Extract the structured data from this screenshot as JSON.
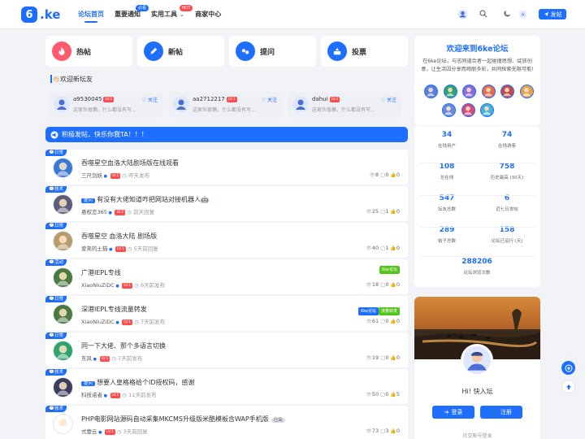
{
  "header": {
    "logo_letter": "6",
    "logo_text": ".ke",
    "nav": [
      {
        "label": "论坛首页",
        "active": true
      },
      {
        "label": "重要通知",
        "badge": "必看",
        "badge_color": "#1e6fff"
      },
      {
        "label": "实用工具",
        "badge": "HOT",
        "badge_color": "#ff4d4f"
      },
      {
        "label": "商家中心"
      }
    ],
    "post_button": "发帖"
  },
  "quick_actions": [
    {
      "label": "热帖",
      "icon": "fire-icon",
      "color": "#ff5a6e"
    },
    {
      "label": "新帖",
      "icon": "pencil-icon",
      "color": "#1e6fff"
    },
    {
      "label": "提问",
      "icon": "question-icon",
      "color": "#1e6fff"
    },
    {
      "label": "投票",
      "icon": "vote-icon",
      "color": "#1e6fff"
    }
  ],
  "newbie_title": "👏🏻欢迎新坛友",
  "new_users": [
    {
      "name": "a9530045",
      "level": "LV.1",
      "desc": "这家伙很懒，什么都没有写...",
      "follow": "♡ 关注"
    },
    {
      "name": "aa2712217",
      "level": "LV.1",
      "desc": "这家伙很懒，什么都没有写...",
      "follow": "♡ 关注"
    },
    {
      "name": "dahui",
      "level": "LV.1",
      "desc": "这家伙很懒，什么都没有写...",
      "follow": "♡ 关注"
    }
  ],
  "notice": "积极发帖，快乐你我TA！！！",
  "posts": [
    {
      "tag": "日常",
      "title": "吞噬星空血洛大陆剧场版在线观看",
      "author": "三尺剑妖",
      "level": "LV.1",
      "time": "昨天发布",
      "views": "8",
      "comments": "0",
      "likes": "0",
      "avatar_color": "#3a78d6"
    },
    {
      "tag": "技术",
      "prefix": "提问",
      "title": "有没有大佬知道咋把网站对接机器人🤖",
      "author": "悬权恋365",
      "level": "LV.2",
      "time": "前天回复",
      "views": "25",
      "comments": "1",
      "likes": "0",
      "avatar_color": "#5b5f7a"
    },
    {
      "tag": "日常",
      "title": "吞噬星空 血洛大陆 剧场版",
      "author": "爱笑的土猫",
      "level": "LV.1",
      "time": "5天前回复",
      "views": "40",
      "comments": "1",
      "likes": "0",
      "avatar_color": "#b89b6b"
    },
    {
      "tag": "活动",
      "title": "广港IEPL专线",
      "author": "XiaoNiuZiDC",
      "level": "LV.1",
      "time": "6天前发布",
      "views": "18",
      "comments": "0",
      "likes": "0",
      "avatar_color": "#4a7a3e",
      "tags": [
        {
          "label": "6ke论坛",
          "color": "#52c41a"
        }
      ]
    },
    {
      "tag": "日常",
      "title": "深港IEPL专线流量转发",
      "author": "XiaoNiuZiDC",
      "level": "LV.1",
      "time": "7天前发布",
      "views": "61",
      "comments": "0",
      "likes": "0",
      "avatar_color": "#4a7a3e",
      "tags": [
        {
          "label": "6ke论坛",
          "color": "#1e6fff"
        },
        {
          "label": "流量转发",
          "color": "#52c41a"
        }
      ]
    },
    {
      "tag": "日常",
      "title": "同一下大佬、那个多语言切换",
      "author": "东风",
      "level": "LV.1",
      "time": "7天前发布",
      "views": "19",
      "comments": "0",
      "likes": "0",
      "avatar_color": "#2fa36b"
    },
    {
      "tag": "技术",
      "prefix": "提问",
      "title": "想要人皇格格给个ID授权码，感谢",
      "author": "科技诺者",
      "level": "LV.1",
      "time": "11天前发布",
      "views": "50",
      "comments": "0",
      "likes": "5",
      "avatar_color": "#3b3f5c"
    },
    {
      "tag": "技术",
      "title": "PHP电影网站源码自动采集MKCMS升级版米酷模板含WAP手机版",
      "title_badge": "已采",
      "author": "式壹云",
      "level": "LV.1",
      "time": "3天前回复",
      "views": "73",
      "comments": "3",
      "likes": "0",
      "avatar_color": "#ffffff"
    }
  ],
  "sidebar": {
    "welcome_title": "欢迎来到6ke论坛",
    "welcome_desc": "在6ke论坛，与志同道合者一起碰撞思想、绽放创意，让生活因分享而绚丽多彩，共同探索无限可能!",
    "avatar_colors": [
      "#5b7fd6",
      "#2fa36b",
      "#8a6ad6",
      "#e86a4a",
      "#c24a4a",
      "#e8a04a",
      "#6a8ad6",
      "#d64a7a",
      "#4ab0d6"
    ],
    "stats": [
      {
        "value": "34",
        "label": "在线用户"
      },
      {
        "value": "74",
        "label": "在线游客"
      },
      {
        "value": "108",
        "label": "总在线"
      },
      {
        "value": "758",
        "label": "历史最高 (30天)"
      },
      {
        "value": "547",
        "label": "坛友总数"
      },
      {
        "value": "6",
        "label": "近七日发帖"
      },
      {
        "value": "289",
        "label": "帖子总数"
      },
      {
        "value": "158",
        "label": "论坛已运行 (天)"
      },
      {
        "value": "288206",
        "label": "论坛浏览次数"
      }
    ],
    "greeting": "Hi! 快入坛",
    "login_button": "登录",
    "register_button": "注册",
    "social_login": "社交账号登录"
  }
}
